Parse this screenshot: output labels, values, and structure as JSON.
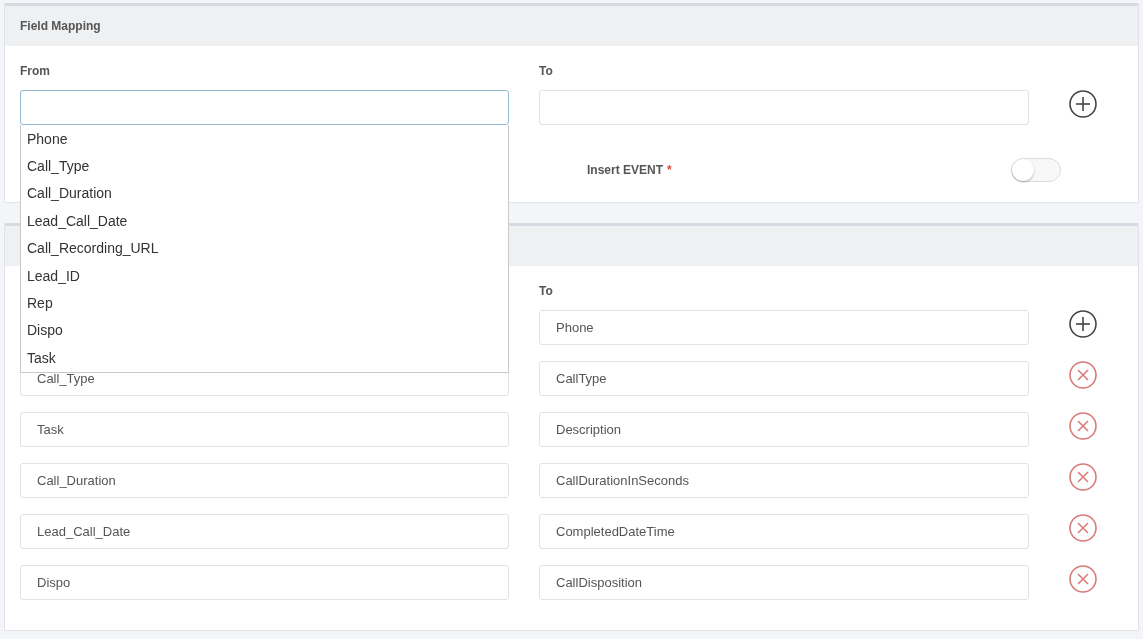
{
  "panels": [
    {
      "title": "Field Mapping",
      "from_label": "From",
      "to_label": "To",
      "rows": [
        {
          "kind": "add",
          "from": {
            "focused": true,
            "suggestions": [
              "Phone",
              "Call_Type",
              "Call_Duration",
              "Lead_Call_Date",
              "Call_Recording_URL",
              "Lead_ID",
              "Rep",
              "Dispo",
              "Task"
            ]
          },
          "to": {
            "focused": false
          }
        }
      ],
      "insert_event": {
        "label": "Insert EVENT",
        "required_mark": "*",
        "on": false
      }
    },
    {
      "to_label": "To",
      "rows": [
        {
          "kind": "add",
          "to": {
            "value": "Phone",
            "focused": false
          }
        },
        {
          "kind": "remove",
          "from": {
            "value": "Call_Type",
            "focused": false
          },
          "to": {
            "value": "CallType",
            "focused": false
          }
        },
        {
          "kind": "remove",
          "from": {
            "value": "Task",
            "focused": false
          },
          "to": {
            "value": "Description",
            "focused": false
          }
        },
        {
          "kind": "remove",
          "from": {
            "value": "Call_Duration",
            "focused": false
          },
          "to": {
            "value": "CallDurationInSeconds",
            "focused": false
          }
        },
        {
          "kind": "remove",
          "from": {
            "value": "Lead_Call_Date",
            "focused": false
          },
          "to": {
            "value": "CompletedDateTime",
            "focused": false
          }
        },
        {
          "kind": "remove",
          "from": {
            "value": "Dispo",
            "focused": false
          },
          "to": {
            "value": "CallDisposition",
            "focused": false
          }
        }
      ]
    }
  ]
}
